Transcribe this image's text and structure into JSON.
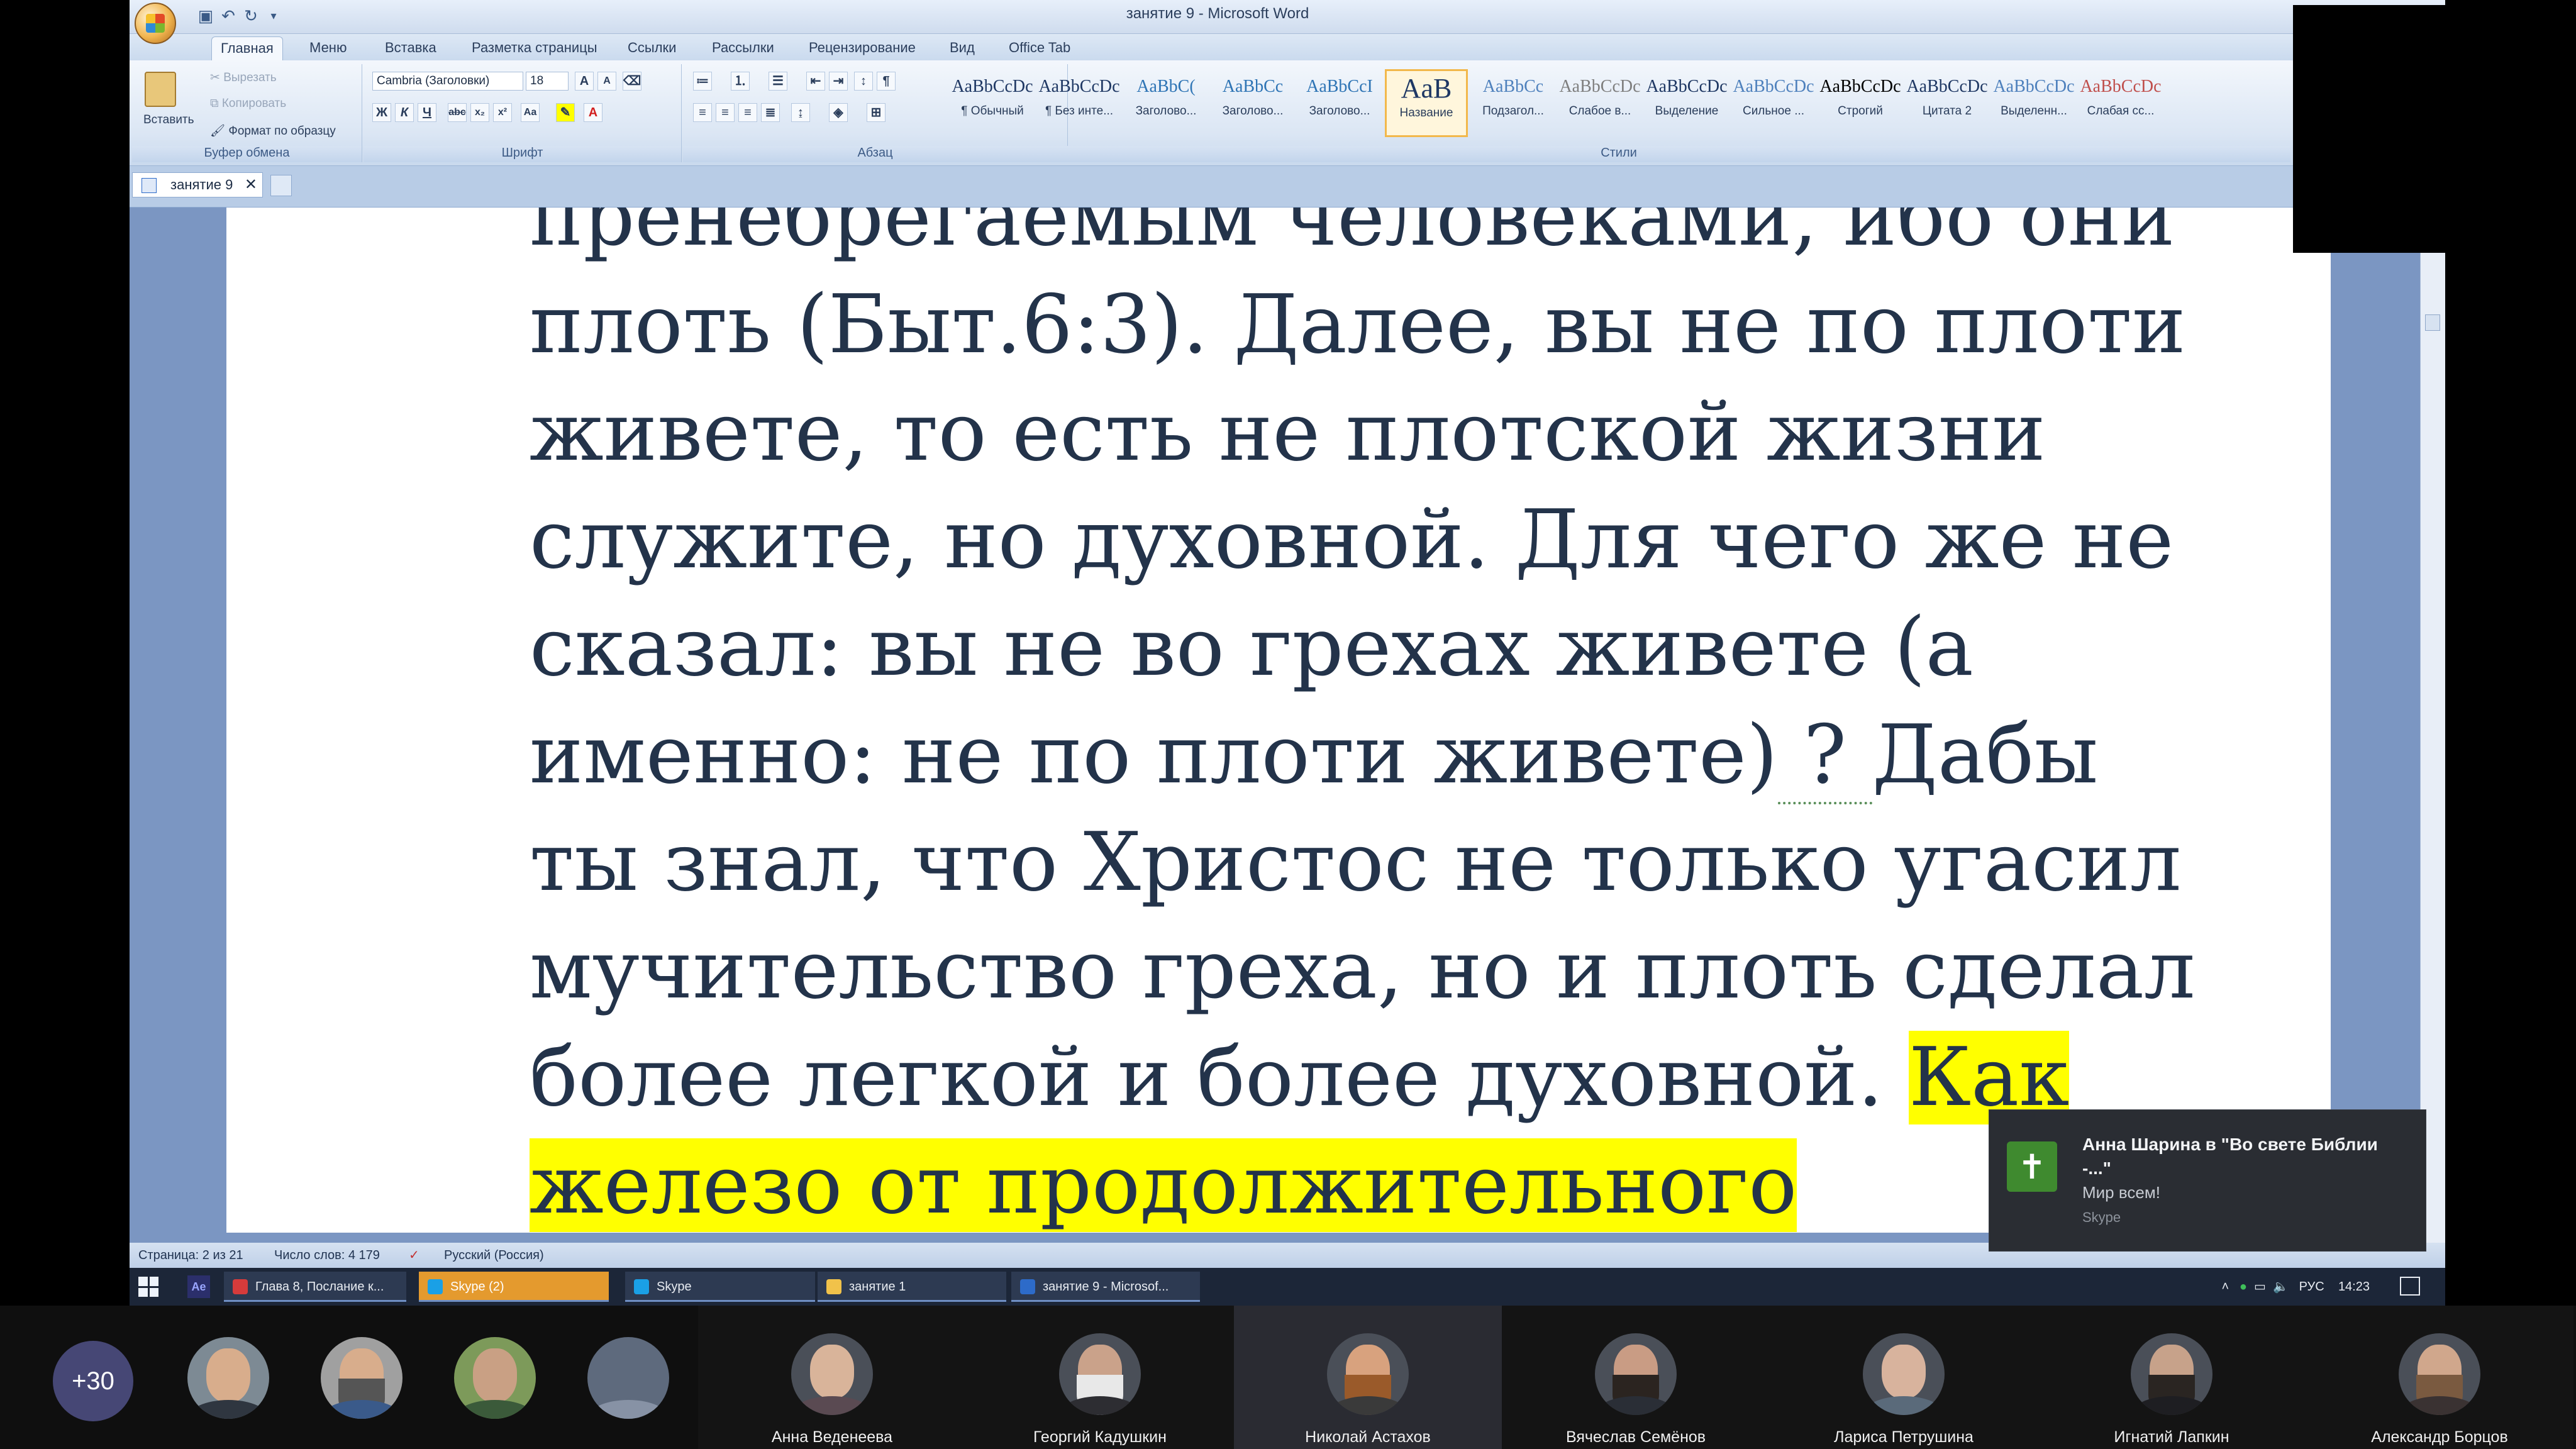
{
  "word": {
    "title": "занятие 9 - Microsoft Word",
    "tabs": [
      "Главная",
      "Меню",
      "Вставка",
      "Разметка страницы",
      "Ссылки",
      "Рассылки",
      "Рецензирование",
      "Вид",
      "Office Tab"
    ],
    "clipboard": {
      "paste": "Вставить",
      "cut": "Вырезать",
      "copy": "Копировать",
      "format_painter": "Формат по образцу",
      "label": "Буфер обмена"
    },
    "font": {
      "name": "Cambria (Заголовки)",
      "size": "18",
      "label": "Шрифт"
    },
    "paragraph": {
      "label": "Абзац"
    },
    "styles": {
      "label": "Стили",
      "items": [
        {
          "sample": "AaBbCcDc",
          "name": "¶ Обычный"
        },
        {
          "sample": "AaBbCcDc",
          "name": "¶ Без инте..."
        },
        {
          "sample": "AaBbC(",
          "name": "Заголово..."
        },
        {
          "sample": "AaBbCc",
          "name": "Заголово..."
        },
        {
          "sample": "AaBbCcI",
          "name": "Заголово..."
        },
        {
          "sample": "AaB",
          "name": "Название"
        },
        {
          "sample": "AaBbCc",
          "name": "Подзагол..."
        },
        {
          "sample": "AaBbCcDc",
          "name": "Слабое в..."
        },
        {
          "sample": "AaBbCcDc",
          "name": "Выделение"
        },
        {
          "sample": "AaBbCcDc",
          "name": "Сильное ..."
        },
        {
          "sample": "AaBbCcDc",
          "name": "Строгий"
        },
        {
          "sample": "AaBbCcDc",
          "name": "Цитата 2"
        },
        {
          "sample": "AaBbCcDc",
          "name": "Выделенн..."
        },
        {
          "sample": "AaBbCcDc",
          "name": "Слабая сс..."
        }
      ]
    },
    "doc_tab": "занятие 9",
    "text": {
      "line0": "пренебрегаемым человеками, ибо они",
      "line1": "плоть (Быт.6:3). Далее, вы не по плоти",
      "line2": "живете, то есть не плотской жизни",
      "line3": "служите, но духовной. Для чего же не",
      "line4": "сказал: вы не во грехах живете (а",
      "line5a": "именно: не по плоти живете)",
      "line5b": " ? ",
      "line5c": "Дабы",
      "line6": "ты знал, что Христос не только угасил",
      "line7": "мучительство греха, но и плоть сделал",
      "line8a": "более легкой и более духовной. ",
      "line8b": "Как",
      "line9": "железо от продолжительного"
    },
    "status": {
      "page": "Страница: 2 из 21",
      "words": "Число слов: 4 179",
      "language": "Русский (Россия)"
    }
  },
  "taskbar": {
    "items": [
      {
        "label": "Глава 8, Послание к...",
        "color": "#d63b3b"
      },
      {
        "label": "Skype (2)",
        "color": "#1aa0e6"
      },
      {
        "label": "Skype",
        "color": "#1aa0e6"
      },
      {
        "label": "занятие 1",
        "color": "#f1c24a"
      },
      {
        "label": "занятие 9 - Microsof...",
        "color": "#2d6bc9"
      }
    ],
    "lang": "РУС",
    "time": "14:23"
  },
  "notification": {
    "title": "Анна Шарина в \"Во свете Библии -...\"",
    "message": "Мир всем!",
    "source": "Skype"
  },
  "participants": {
    "more": "+30",
    "tiles": [
      {
        "name": "Анна Веденеева"
      },
      {
        "name": "Георгий Кадушкин"
      },
      {
        "name": "Николай Астахов"
      },
      {
        "name": "Вячеслав Семёнов"
      },
      {
        "name": "Лариса Петрушина"
      },
      {
        "name": "Игнатий Лапкин"
      },
      {
        "name": "Александр Борцов"
      }
    ]
  }
}
